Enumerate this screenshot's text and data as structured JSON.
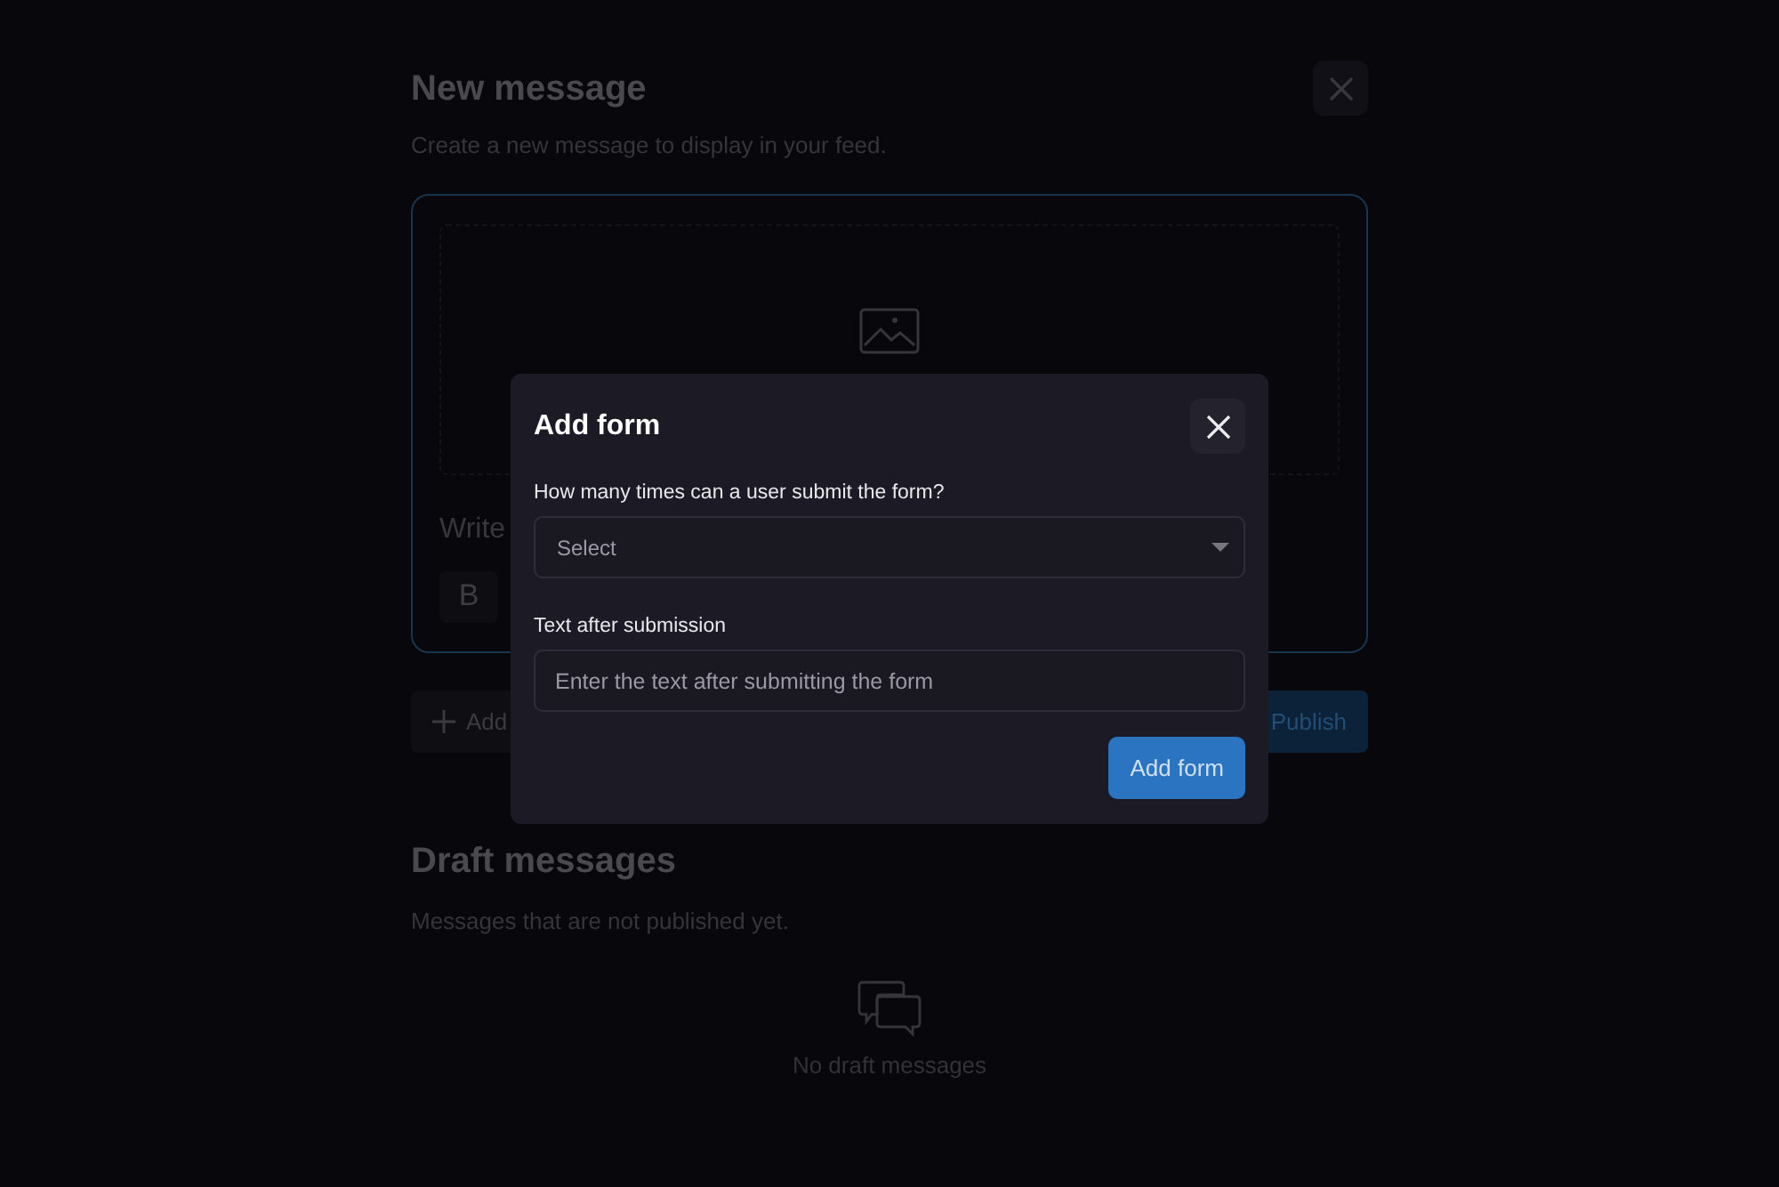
{
  "page": {
    "title": "New message",
    "subtitle": "Create a new message to display in your feed.",
    "editor": {
      "placeholder": "Write",
      "toolbar": [
        "B"
      ]
    },
    "actions": {
      "add": "Add",
      "publish": "Publish"
    },
    "drafts": {
      "title": "Draft messages",
      "subtitle": "Messages that are not published yet.",
      "empty": "No draft messages"
    }
  },
  "dialog": {
    "title": "Add form",
    "fields": [
      {
        "kind": "select",
        "label": "How many times can a user submit the form?",
        "placeholder": "Select"
      },
      {
        "kind": "text",
        "label": "Text after submission",
        "placeholder": "Enter the text after submitting the form"
      }
    ],
    "submit": "Add form"
  }
}
